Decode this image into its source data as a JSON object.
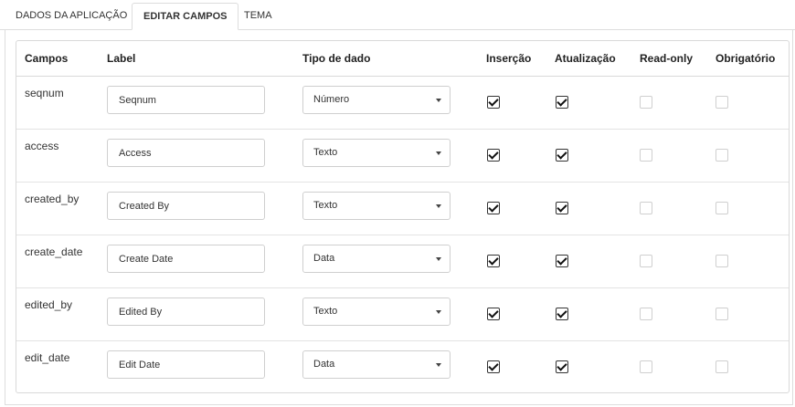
{
  "tabs": [
    {
      "label": "DADOS DA APLICAÇÃO",
      "active": false
    },
    {
      "label": "EDITAR CAMPOS",
      "active": true
    },
    {
      "label": "TEMA",
      "active": false
    }
  ],
  "columns": {
    "campos": "Campos",
    "label": "Label",
    "tipo": "Tipo de dado",
    "insercao": "Inserção",
    "atualizacao": "Atualização",
    "readonly": "Read-only",
    "obrigatorio": "Obrigatório"
  },
  "rows": [
    {
      "field": "seqnum",
      "label": "Seqnum",
      "type": "Número",
      "insercao": true,
      "atualizacao": true,
      "readonly": false,
      "obrigatorio": false
    },
    {
      "field": "access",
      "label": "Access",
      "type": "Texto",
      "insercao": true,
      "atualizacao": true,
      "readonly": false,
      "obrigatorio": false
    },
    {
      "field": "created_by",
      "label": "Created By",
      "type": "Texto",
      "insercao": true,
      "atualizacao": true,
      "readonly": false,
      "obrigatorio": false
    },
    {
      "field": "create_date",
      "label": "Create Date",
      "type": "Data",
      "insercao": true,
      "atualizacao": true,
      "readonly": false,
      "obrigatorio": false
    },
    {
      "field": "edited_by",
      "label": "Edited By",
      "type": "Texto",
      "insercao": true,
      "atualizacao": true,
      "readonly": false,
      "obrigatorio": false
    },
    {
      "field": "edit_date",
      "label": "Edit Date",
      "type": "Data",
      "insercao": true,
      "atualizacao": true,
      "readonly": false,
      "obrigatorio": false
    }
  ]
}
